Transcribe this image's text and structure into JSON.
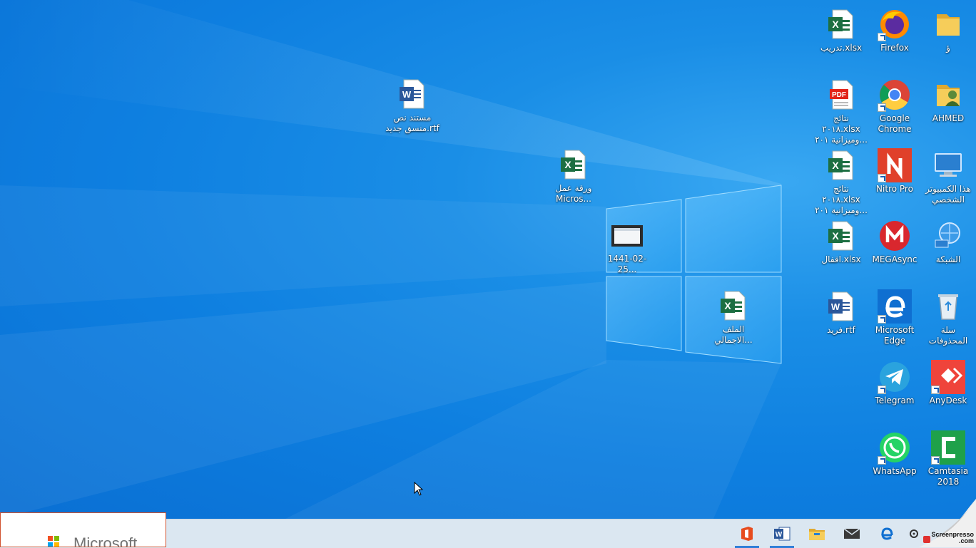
{
  "desktop": {
    "icons": {
      "folder_dhal": "ؤ",
      "firefox": "Firefox",
      "tadrib": "تدريب.xlsx",
      "ahmed": "AHMED",
      "chrome": "Google Chrome",
      "results_pdf": "نتائج ٢٠١٨.xlsx وميزانية ٢٠١...",
      "this_pc": "هذا الكمبيوتر الشخصي",
      "nitro": "Nitro Pro",
      "results_xlsx": "نتائج ٢٠١٨.xlsx وميزانية ٢٠١...",
      "network": "الشبكة",
      "mega": "MEGAsync",
      "aqfal": "اقفال.xlsx",
      "recycle": "سلة المحذوفات",
      "edge": "Microsoft Edge",
      "farid": "فريد.rtf",
      "anydesk": "AnyDesk",
      "telegram": "Telegram",
      "camtasia": "Camtasia 2018",
      "whatsapp": "WhatsApp",
      "rtf_doc": "مستند نص منسق جديد.rtf",
      "excel_sheet": "ورقة عمل Micros...",
      "video": "1441-02-25...",
      "ijmali": "الملف الاجمالي..."
    }
  },
  "popup": {
    "brand": "Microsoft"
  },
  "watermark": {
    "line1": "Screenpresso",
    "line2": ".com"
  },
  "colors": {
    "excel": "#1d6f42",
    "word": "#2b579a",
    "pdf": "#e2231a",
    "mega": "#d9272e",
    "nitro": "#e0402a",
    "anydesk": "#ef443b",
    "camtasia": "#1fa14a",
    "whatsapp": "#25d366",
    "telegram": "#2aa3de",
    "edge": "#0f6fd1",
    "folder": "#f2c14e"
  }
}
